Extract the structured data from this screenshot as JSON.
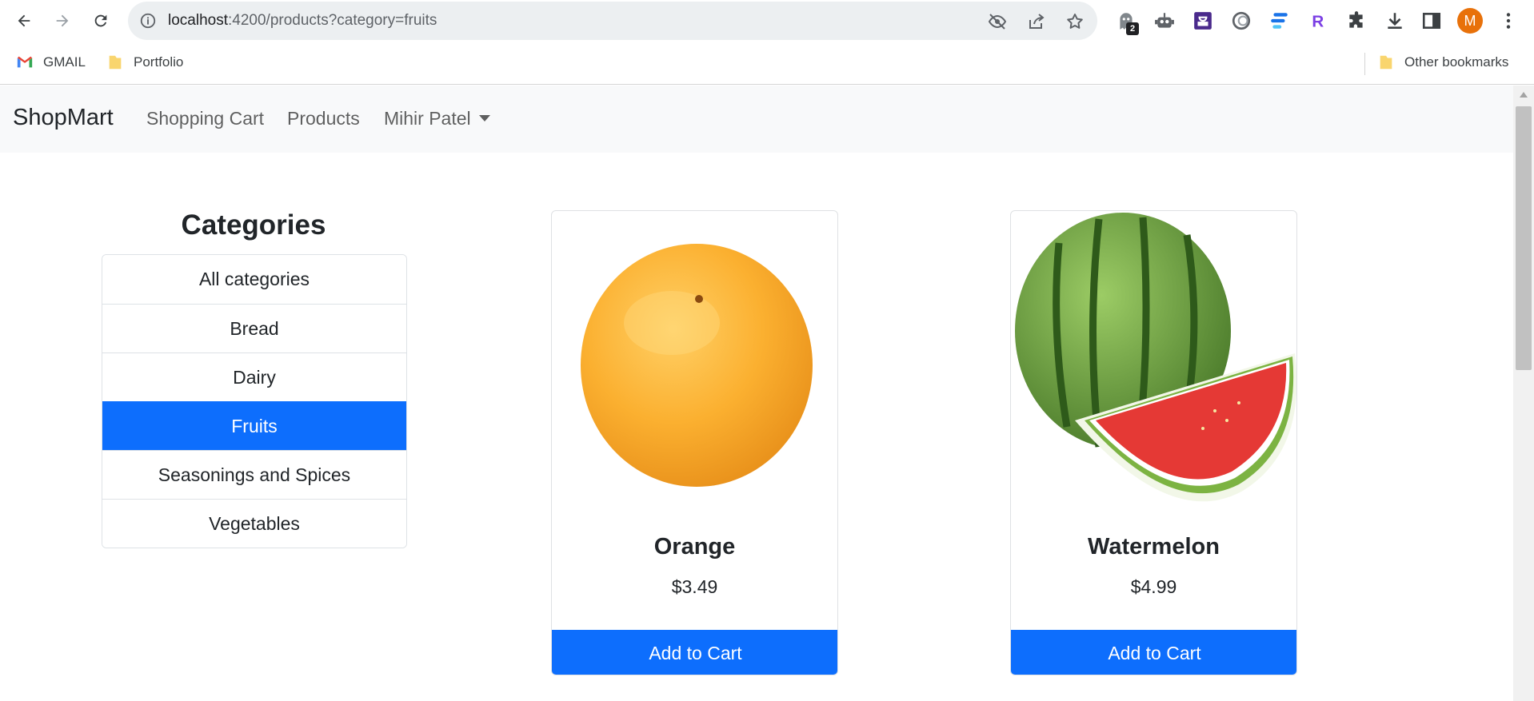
{
  "browser": {
    "url_host": "localhost",
    "url_path": ":4200/products?category=fruits",
    "extension_badge": "2",
    "profile_initial": "M",
    "bookmarks": [
      {
        "label": "GMAIL",
        "icon": "gmail-icon"
      },
      {
        "label": "Portfolio",
        "icon": "folder-icon"
      }
    ],
    "other_bookmarks": "Other bookmarks"
  },
  "navbar": {
    "brand": "ShopMart",
    "links": [
      "Shopping Cart",
      "Products"
    ],
    "user_menu": "Mihir Patel"
  },
  "categories": {
    "title": "Categories",
    "items": [
      "All categories",
      "Bread",
      "Dairy",
      "Fruits",
      "Seasonings and Spices",
      "Vegetables"
    ],
    "active": "Fruits"
  },
  "products": [
    {
      "name": "Orange",
      "price": "$3.49",
      "button": "Add to Cart",
      "image": "orange-image"
    },
    {
      "name": "Watermelon",
      "price": "$4.99",
      "button": "Add to Cart",
      "image": "watermelon-image"
    }
  ],
  "colors": {
    "primary": "#0d6efd",
    "navbar_bg": "#f8f9fa",
    "avatar": "#e8710a"
  }
}
